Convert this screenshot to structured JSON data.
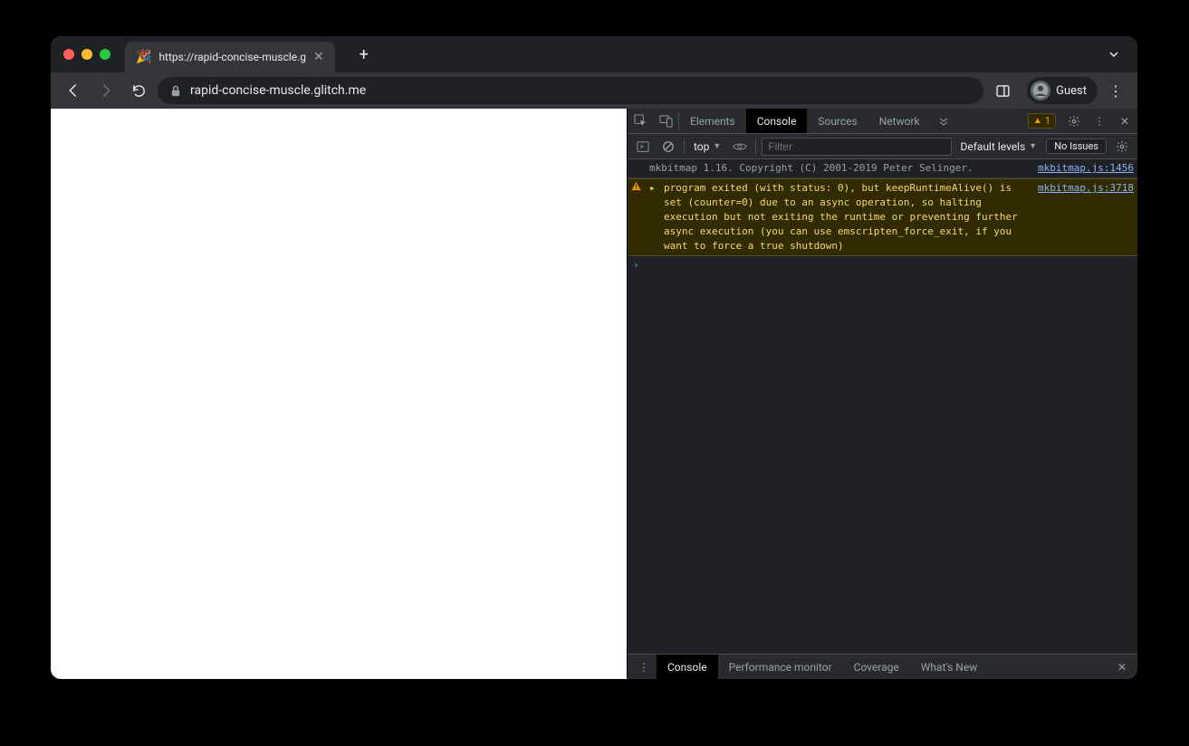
{
  "tab": {
    "title": "https://rapid-concise-muscle.g",
    "favicon": "🎉"
  },
  "toolbar": {
    "url": "rapid-concise-muscle.glitch.me",
    "profile_label": "Guest"
  },
  "devtools": {
    "tabs": {
      "elements": "Elements",
      "console": "Console",
      "sources": "Sources",
      "network": "Network"
    },
    "warn_count": "1",
    "filter": {
      "context": "top",
      "placeholder": "Filter",
      "levels": "Default levels",
      "issues": "No Issues"
    },
    "logs": {
      "info_msg": "mkbitmap 1.16. Copyright (C) 2001-2019 Peter Selinger.",
      "info_src": "mkbitmap.js:1456",
      "warn_msg": "program exited (with status: 0), but keepRuntimeAlive() is set (counter=0) due to an async operation, so halting execution but not exiting the runtime or preventing further async execution (you can use emscripten_force_exit, if you want to force a true shutdown)",
      "warn_src": "mkbitmap.js:3718"
    },
    "drawer": {
      "console": "Console",
      "perf": "Performance monitor",
      "coverage": "Coverage",
      "whatsnew": "What's New"
    }
  }
}
